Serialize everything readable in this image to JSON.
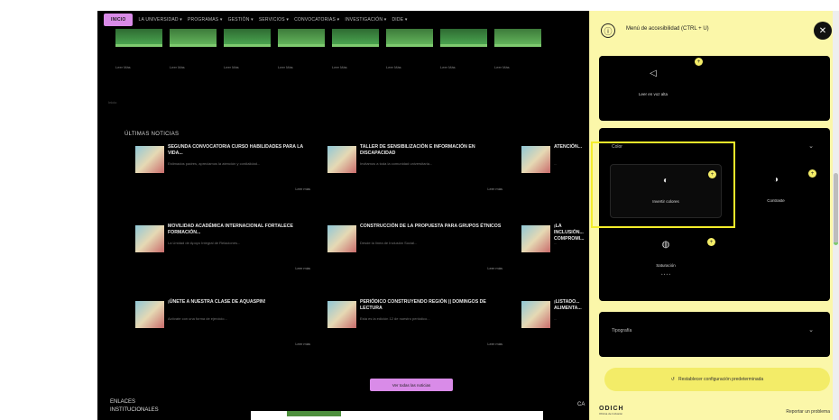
{
  "nav": {
    "items": [
      "INICIO",
      "LA UNIVERSIDAD ▾",
      "PROGRAMAS ▾",
      "GESTIÓN ▾",
      "SERVICIOS ▾",
      "CONVOCATORIAS ▾",
      "INVESTIGACIÓN ▾",
      "DIDE ▾"
    ]
  },
  "thumb_read_more": [
    "Leer Más",
    "Leer Más",
    "Leer Más",
    "Leer Más",
    "Leer Más",
    "Leer Más",
    "Leer Más",
    "Leer Más"
  ],
  "crumb": "Inicio",
  "news": {
    "title": "ÚLTIMAS NOTICIAS",
    "cards": [
      {
        "title": "SEGUNDA CONVOCATORIA CURSO HABILIDADES PARA LA VIDA...",
        "desc": "Estimados padres, apreciamos la atención y cordialidad...",
        "more": "Leer más"
      },
      {
        "title": "TALLER DE SENSIBILIZACIÓN E INFORMACIÓN EN DISCAPACIDAD",
        "desc": "Invitamos a toda la comunidad universitaria...",
        "more": "Leer más"
      },
      {
        "title": "ATENCIÓN...",
        "desc": "...",
        "more": ""
      },
      {
        "title": "MOVILIDAD ACADÉMICA INTERNACIONAL FORTALECE FORMACIÓN...",
        "desc": "La Unidad de Apoyo Integral de Relaciones...",
        "more": "Leer más"
      },
      {
        "title": "CONSTRUCCIÓN DE LA PROPUESTA PARA GRUPOS ÉTNICOS",
        "desc": "Desde la línea de Inclusión Social...",
        "more": "Leer más"
      },
      {
        "title": "¡LA INCLUSIÓN... COMPROMI...",
        "desc": "...",
        "more": ""
      },
      {
        "title": "¡ÚNETE A NUESTRA CLASE DE AQUASPIN!",
        "desc": "Actívate con una forma de ejercicio...",
        "more": "Leer más"
      },
      {
        "title": "PERIÓDICO CONSTRUYENDO REGIÓN || DOMINGOS DE LECTURA",
        "desc": "Esta es la edición 12 de nuestro periódico...",
        "more": "Leer más"
      },
      {
        "title": "¡LISTADO... ALIMENTA...",
        "desc": "...",
        "more": ""
      }
    ],
    "view_all": "Ver todas las noticias"
  },
  "links_title": "ENLACES INSTITUCIONALES",
  "ca_label": "CA",
  "panel": {
    "title": "Menú de accesibilidad (CTRL + U)",
    "read_aloud": "Leer en voz alta",
    "color_section": "Color",
    "invert": "Invertir colores",
    "contrast": "Contraste",
    "saturation": "Saturación",
    "saturation_dots": "• • • •",
    "typography": "Tipografía",
    "reset": "Restablecer configuración predeterminada",
    "logo": "ODICH",
    "logo_sub": "Oficina de Inclusión",
    "report": "Reportar un problema"
  },
  "colors": {
    "accent_pink": "#d98be8",
    "panel_yellow": "#fbf7a9",
    "focus_yellow": "#f4ee2a"
  },
  "icons": [
    "info-icon",
    "close-icon",
    "speaker-icon",
    "invert-icon",
    "contrast-icon",
    "saturation-icon",
    "chevron-down-icon",
    "reset-icon"
  ]
}
